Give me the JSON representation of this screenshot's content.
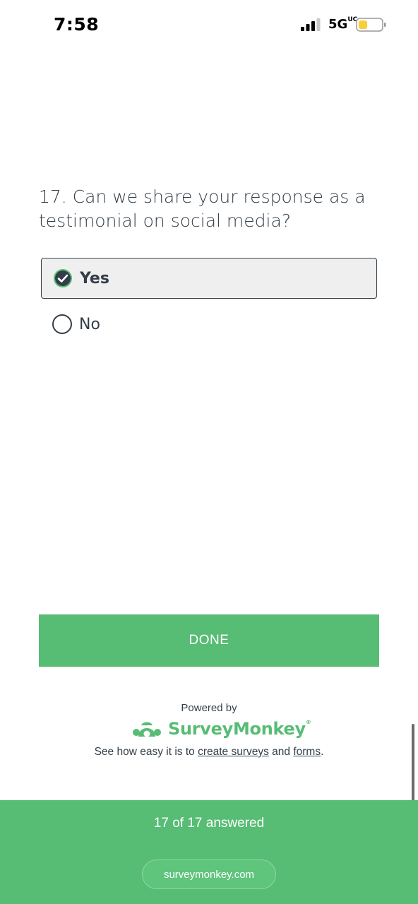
{
  "status_bar": {
    "time": "7:58",
    "network": "5G",
    "network_suffix": "UC"
  },
  "question": {
    "text": "17. Can we share your response as a testimonial on social media?",
    "options": [
      {
        "label": "Yes",
        "selected": true
      },
      {
        "label": "No",
        "selected": false
      }
    ]
  },
  "done_button": {
    "label": "DONE"
  },
  "branding": {
    "powered_by": "Powered by",
    "brand_name": "SurveyMonkey",
    "registered_mark": "®",
    "promo_prefix": "See how easy it is to ",
    "promo_link1": "create surveys",
    "promo_middle": " and ",
    "promo_link2": "forms",
    "promo_suffix": "."
  },
  "footer": {
    "progress": "17 of 17 answered",
    "site": "surveymonkey.com"
  },
  "colors": {
    "brand_green": "#57bc74",
    "text_dark": "#333e48",
    "selected_bg": "#efefef"
  }
}
